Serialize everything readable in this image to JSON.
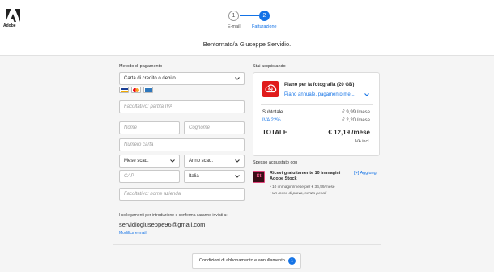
{
  "brand": {
    "logo_text": "Adobe",
    "accent": "#1473e6",
    "logo_color": "#222222"
  },
  "steps": [
    {
      "number": "1",
      "label": "E-mail"
    },
    {
      "number": "2",
      "label": "Fatturazione"
    }
  ],
  "welcome": "Bentornato/a Giuseppe Servidio.",
  "payment": {
    "title": "Metodo di pagamento",
    "method_value": "Carta di credito o debito",
    "card_icons": [
      "visa-icon",
      "mastercard-icon",
      "amex-icon"
    ],
    "vat_placeholder": "Facoltativo: partita IVA",
    "first_name_placeholder": "Nome",
    "last_name_placeholder": "Cognome",
    "card_number_placeholder": "Numero carta",
    "exp_month": "Mese scad.",
    "exp_year": "Anno scad.",
    "cap_placeholder": "CAP",
    "country": "Italia",
    "company_placeholder": "Facoltativo: nome azienda"
  },
  "email_section": {
    "note": "I collegamenti per introduzione e conferma saranno inviati a:",
    "email": "servidiogiuseppe96@gmail.com",
    "edit_label": "Modifica e-mail"
  },
  "summary": {
    "title": "Stai acquistando",
    "product": "Piano per la fotografia (20 GB)",
    "plan": "Piano annuale, pagamento me...",
    "subtotal_label": "Subtotale",
    "subtotal_value": "€ 9,99 /mese",
    "vat_label": "IVA 22%",
    "vat_value": "€ 2,20 /mese",
    "total_label": "TOTALE",
    "total_value": "€ 12,19 /mese",
    "vat_included": "IVA incl."
  },
  "stock": {
    "section_title": "Spesso acquistato con",
    "icon_text": "St",
    "title": "Ricevi gratuitamente 10 immagini Adobe Stock",
    "add_label": "[+] Aggiungi",
    "line1": "• 10 immagini/mese per € 36,59/mese",
    "line2": "• Un mese di prova, senza penali"
  },
  "terms": {
    "label": "Condizioni di abbonamento e annullamento",
    "info_glyph": "i"
  }
}
